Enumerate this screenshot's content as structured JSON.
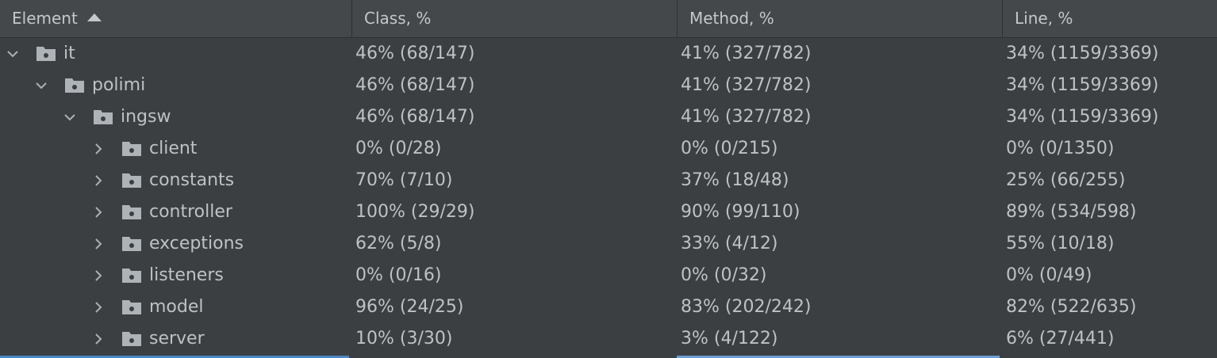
{
  "header": {
    "element": "Element",
    "class": "Class, %",
    "method": "Method, %",
    "line": "Line, %"
  },
  "rows": [
    {
      "name": "it",
      "expanded": true,
      "class": "46% (68/147)",
      "method": "41% (327/782)",
      "line": "34% (1159/3369)"
    },
    {
      "name": "polimi",
      "expanded": true,
      "class": "46% (68/147)",
      "method": "41% (327/782)",
      "line": "34% (1159/3369)"
    },
    {
      "name": "ingsw",
      "expanded": true,
      "class": "46% (68/147)",
      "method": "41% (327/782)",
      "line": "34% (1159/3369)"
    },
    {
      "name": "client",
      "expanded": false,
      "class": "0% (0/28)",
      "method": "0% (0/215)",
      "line": "0% (0/1350)"
    },
    {
      "name": "constants",
      "expanded": false,
      "class": "70% (7/10)",
      "method": "37% (18/48)",
      "line": "25% (66/255)"
    },
    {
      "name": "controller",
      "expanded": false,
      "class": "100% (29/29)",
      "method": "90% (99/110)",
      "line": "89% (534/598)"
    },
    {
      "name": "exceptions",
      "expanded": false,
      "class": "62% (5/8)",
      "method": "33% (4/12)",
      "line": "55% (10/18)"
    },
    {
      "name": "listeners",
      "expanded": false,
      "class": "0% (0/16)",
      "method": "0% (0/32)",
      "line": "0% (0/49)"
    },
    {
      "name": "model",
      "expanded": false,
      "class": "96% (24/25)",
      "method": "83% (202/242)",
      "line": "82% (522/635)"
    },
    {
      "name": "server",
      "expanded": false,
      "class": "10% (3/30)",
      "method": "3% (4/122)",
      "line": "6% (27/441)"
    }
  ],
  "icons": {
    "sort": "sort-ascending-icon",
    "expanded": "chevron-down-icon",
    "collapsed": "chevron-right-icon",
    "package": "package-folder-icon"
  },
  "colors": {
    "background": "#3c3f41",
    "header": "#45484a",
    "text": "#bfc1c3",
    "folder": "#aeb3b8",
    "accent": "#4a88c7"
  }
}
